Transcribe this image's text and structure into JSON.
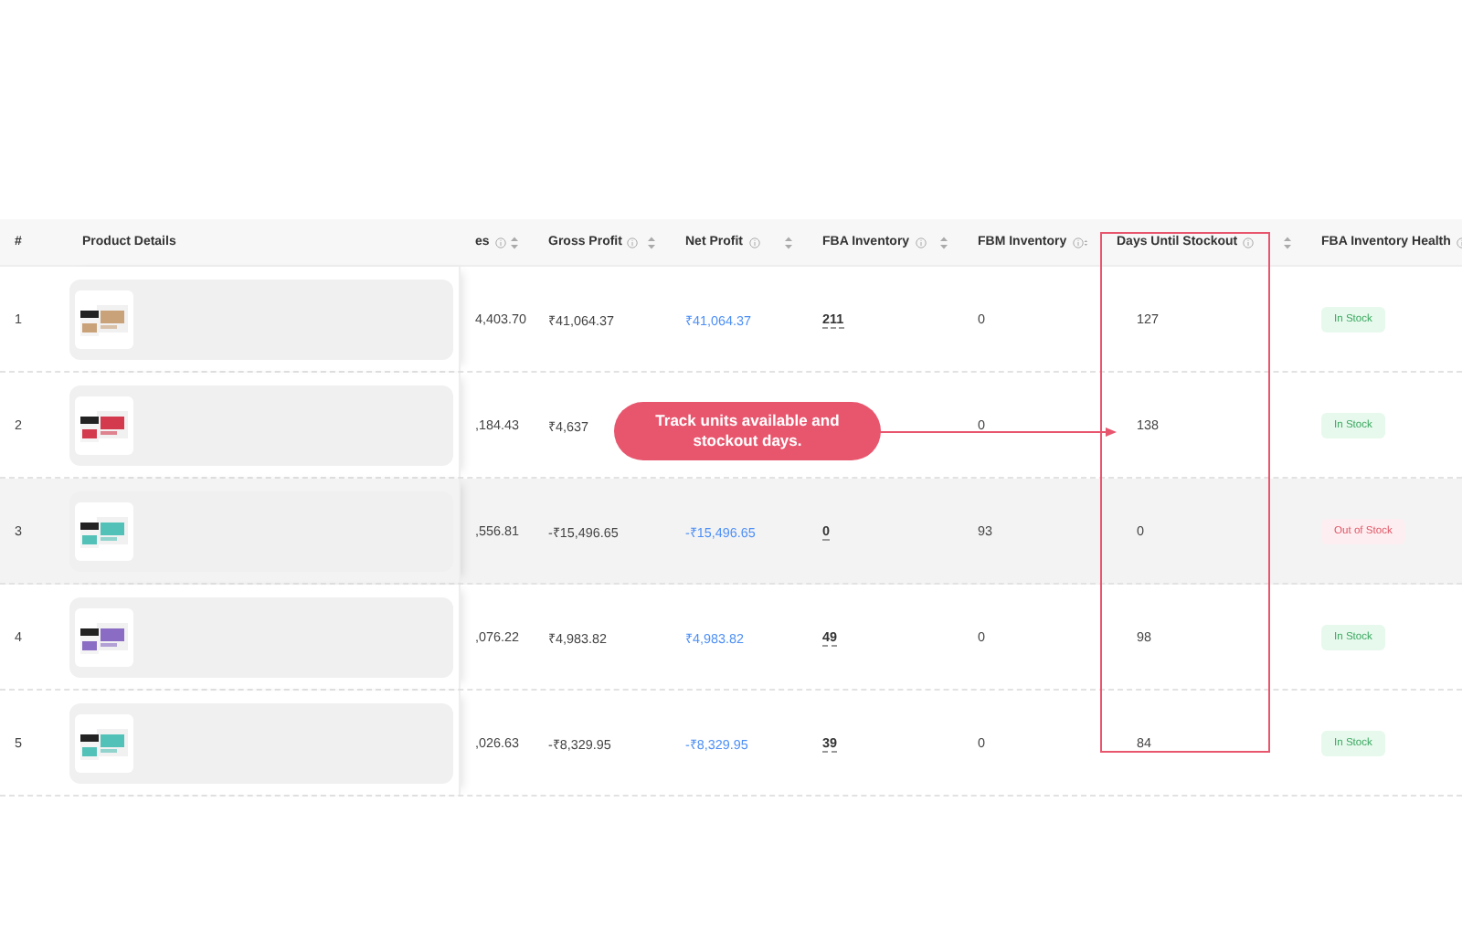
{
  "columns": [
    {
      "label": "#",
      "info": false,
      "sortable": false
    },
    {
      "label": "Product Details",
      "info": false,
      "sortable": false
    },
    {
      "label": "es",
      "info": true,
      "sortable": true
    },
    {
      "label": "Gross Profit",
      "info": true,
      "sortable": true
    },
    {
      "label": "Net Profit",
      "info": true,
      "sortable": true
    },
    {
      "label": "FBA Inventory",
      "info": true,
      "sortable": true
    },
    {
      "label": "FBM Inventory",
      "info": true,
      "sortable": true
    },
    {
      "label": "Days Until Stockout",
      "info": true,
      "sortable": true
    },
    {
      "label": "FBA Inventory Health",
      "info": true,
      "sortable": false
    }
  ],
  "rows": [
    {
      "number": "1",
      "highlighted": false,
      "sales": "4,403.70",
      "gross_profit": "₹41,064.37",
      "net_profit": "₹41,064.37",
      "fba_inventory": "211",
      "fbm_inventory": "0",
      "days_until_stockout": "127",
      "health": {
        "label": "In Stock",
        "kind": "in_stock"
      }
    },
    {
      "number": "2",
      "highlighted": false,
      "sales": ",184.43",
      "gross_profit": "₹4,637",
      "fbm_inventory": "0",
      "days_until_stockout": "138",
      "health": {
        "label": "In Stock",
        "kind": "in_stock"
      }
    },
    {
      "number": "3",
      "highlighted": true,
      "sales": ",556.81",
      "gross_profit": "-₹15,496.65",
      "net_profit": "-₹15,496.65",
      "fba_inventory": "0",
      "fbm_inventory": "93",
      "days_until_stockout": "0",
      "health": {
        "label": "Out of Stock",
        "kind": "out_of_stock"
      }
    },
    {
      "number": "4",
      "highlighted": false,
      "sales": ",076.22",
      "gross_profit": "₹4,983.82",
      "net_profit": "₹4,983.82",
      "fba_inventory": "49",
      "fbm_inventory": "0",
      "days_until_stockout": "98",
      "health": {
        "label": "In Stock",
        "kind": "in_stock"
      }
    },
    {
      "number": "5",
      "highlighted": false,
      "sales": ",026.63",
      "gross_profit": "-₹8,329.95",
      "net_profit": "-₹8,329.95",
      "fba_inventory": "39",
      "fbm_inventory": "0",
      "days_until_stockout": "84",
      "health": {
        "label": "In Stock",
        "kind": "in_stock"
      }
    }
  ],
  "callout": {
    "text": "Track units available and stockout days."
  }
}
